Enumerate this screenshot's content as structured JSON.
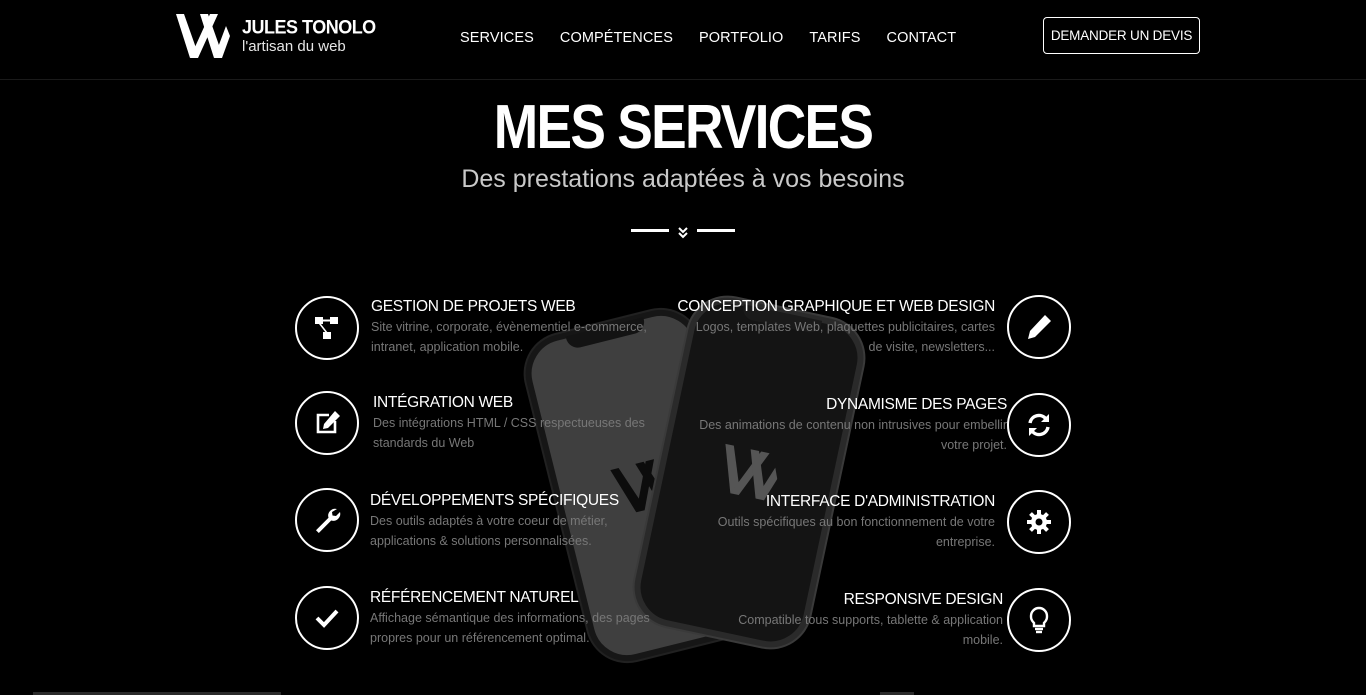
{
  "brand": {
    "name": "JULES TONOLO",
    "tagline": "l'artisan du web"
  },
  "nav": {
    "items": [
      {
        "label": "SERVICES"
      },
      {
        "label": "COMPÉTENCES"
      },
      {
        "label": "PORTFOLIO"
      },
      {
        "label": "TARIFS"
      },
      {
        "label": "CONTACT"
      }
    ],
    "cta_label": "DEMANDER UN DEVIS"
  },
  "hero": {
    "title": "MES SERVICES",
    "subtitle": "Des prestations adaptées à vos besoins"
  },
  "services": {
    "left": [
      {
        "title": "GESTION DE PROJETS WEB",
        "desc1": "Site vitrine, corporate, évènementiel e-commerce,",
        "desc2": "intranet, application mobile.",
        "icon": "sitemap-icon"
      },
      {
        "title": "INTÉGRATION WEB",
        "desc1": "Des intégrations HTML / CSS respectueuses des",
        "desc2": "standards du Web",
        "icon": "edit-icon"
      },
      {
        "title": "DÉVELOPPEMENTS SPÉCIFIQUES",
        "desc1": "Des outils adaptés à votre coeur de métier,",
        "desc2": "applications & solutions personnalisées.",
        "icon": "wrench-icon"
      },
      {
        "title": "RÉFÉRENCEMENT NATUREL",
        "desc1": "Affichage sémantique des informations, des pages",
        "desc2": "propres pour un référencement optimal.",
        "icon": "check-icon"
      }
    ],
    "right": [
      {
        "title": "CONCEPTION GRAPHIQUE ET WEB DESIGN",
        "desc1": "Logos, templates Web, plaquettes publicitaires, cartes",
        "desc2": "de visite, newsletters...",
        "icon": "pencil-icon"
      },
      {
        "title": "DYNAMISME DES PAGES",
        "desc1": "Des animations de contenu non intrusives pour embellir",
        "desc2": "votre projet.",
        "icon": "refresh-icon"
      },
      {
        "title": "INTERFACE D'ADMINISTRATION",
        "desc1": "Outils spécifiques au bon fonctionnement de votre",
        "desc2": "entreprise.",
        "icon": "gear-icon"
      },
      {
        "title": "RESPONSIVE DESIGN",
        "desc1": "Compatible tous supports, tablette & application",
        "desc2": "mobile.",
        "icon": "lightbulb-icon"
      }
    ]
  },
  "colors": {
    "background": "#000000",
    "text": "#ffffff",
    "muted": "#777777"
  }
}
